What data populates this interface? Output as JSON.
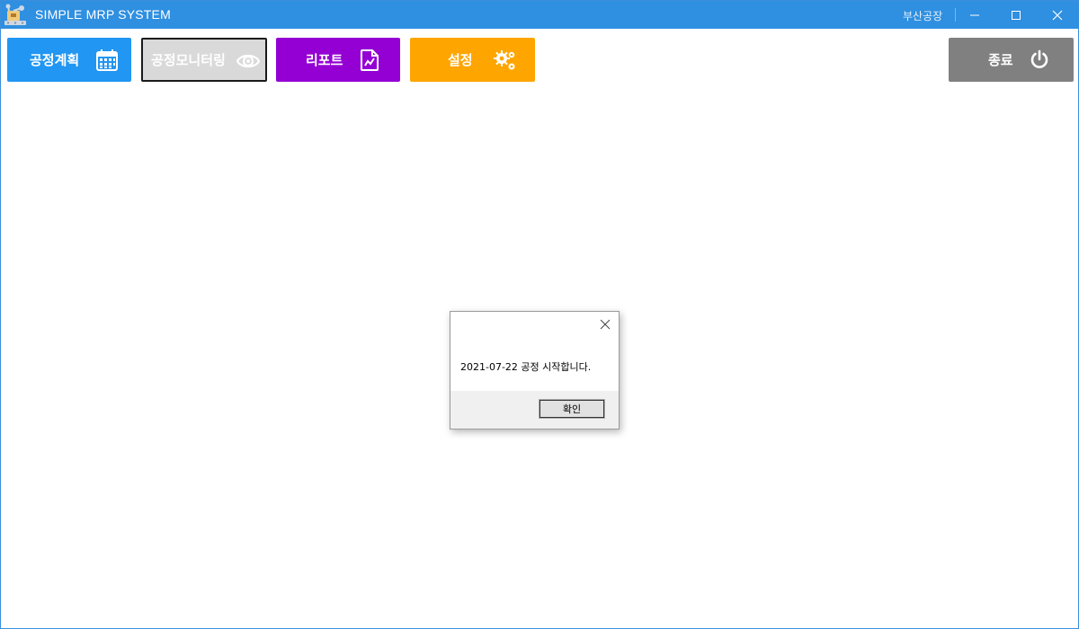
{
  "window": {
    "title": "SIMPLE MRP SYSTEM",
    "factory_name": "부산공장",
    "colors": {
      "titlebar": "#2f8fe0"
    }
  },
  "toolbar": {
    "plan": {
      "label": "공정계획",
      "icon": "calendar-icon",
      "color": "#2196f3"
    },
    "monitor": {
      "label": "공정모니터링",
      "icon": "eye-icon",
      "color": "#d9d9d9"
    },
    "report": {
      "label": "리포트",
      "icon": "report-file-icon",
      "color": "#9400d3"
    },
    "settings": {
      "label": "설정",
      "icon": "gears-icon",
      "color": "#ffa500"
    },
    "exit": {
      "label": "종료",
      "icon": "power-icon",
      "color": "#808080"
    }
  },
  "dialog": {
    "message": "2021-07-22 공정 시작합니다.",
    "ok_label": "확인"
  }
}
